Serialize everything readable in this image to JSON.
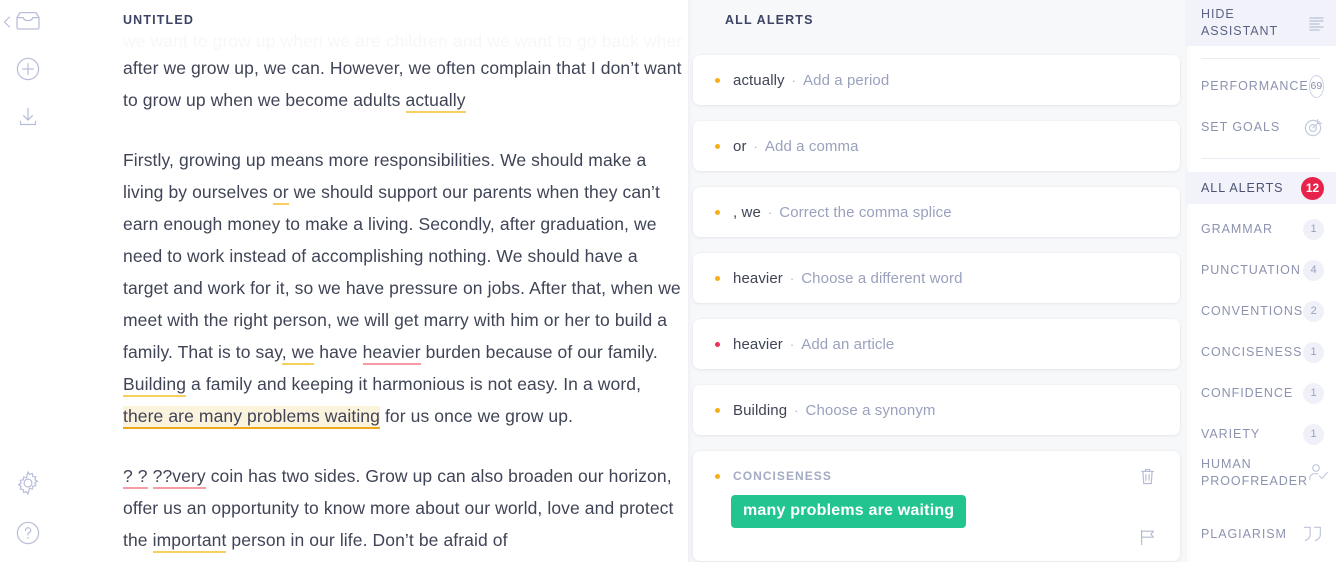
{
  "rail": {
    "back_icon": "chevron-left-icon",
    "icons": [
      {
        "name": "inbox-icon",
        "label": "Inbox"
      },
      {
        "name": "plus-circle-icon",
        "label": "New document"
      },
      {
        "name": "download-icon",
        "label": "Download"
      },
      {
        "name": "gear-icon",
        "label": "Settings"
      },
      {
        "name": "help-circle-icon",
        "label": "Help"
      }
    ]
  },
  "document": {
    "title": "UNTITLED",
    "ghost_line": "we want to grow up when we are children and we want to go back when",
    "paragraphs": [
      {
        "id": "p1",
        "runs": [
          {
            "t": "after we grow up, we can. However, we often complain that I don’t want to grow up when we become adults ",
            "mark": "none"
          },
          {
            "t": "actually",
            "mark": "yellow"
          }
        ]
      },
      {
        "id": "p2",
        "runs": [
          {
            "t": "Firstly, growing up means more responsibilities. We should make a living by ourselves ",
            "mark": "none"
          },
          {
            "t": "or",
            "mark": "yellow"
          },
          {
            "t": " we should support our parents when they can’t earn enough money to make a living. Secondly, after graduation, we need to work instead of accomplishing nothing. We should have a target and work for it, so we have pressure on jobs. After that, when we meet with the right person, we will get marry with him or her to build a family. That is to say",
            "mark": "none"
          },
          {
            "t": ", we",
            "mark": "yellow"
          },
          {
            "t": " have ",
            "mark": "none"
          },
          {
            "t": "heavier",
            "mark": "red"
          },
          {
            "t": " burden because of our family. ",
            "mark": "none"
          },
          {
            "t": "Building",
            "mark": "yellow"
          },
          {
            "t": " a family and keeping it harmonious is not easy. In a word, ",
            "mark": "none"
          },
          {
            "t": "there are many problems waiting",
            "mark": "active"
          },
          {
            "t": " for us once we grow up.",
            "mark": "none"
          }
        ]
      },
      {
        "id": "p3",
        "runs": [
          {
            "t": "? ?",
            "mark": "red"
          },
          {
            "t": " ",
            "mark": "none"
          },
          {
            "t": "??very",
            "mark": "red"
          },
          {
            "t": " coin has two sides. Grow up can also broaden our horizon, offer us an opportunity to know more about our world, love and protect the ",
            "mark": "none"
          },
          {
            "t": "important",
            "mark": "yellow"
          },
          {
            "t": " person in our life. Don’t be afraid of",
            "mark": "none"
          }
        ]
      }
    ]
  },
  "alerts": {
    "title": "ALL ALERTS",
    "separator": "·",
    "items": [
      {
        "word": "actually",
        "action": "Add a period",
        "severity": "amber"
      },
      {
        "word": "or",
        "action": "Add a comma",
        "severity": "amber"
      },
      {
        "word": ", we",
        "action": "Correct the comma splice",
        "severity": "amber"
      },
      {
        "word": "heavier",
        "action": "Choose a different word",
        "severity": "amber"
      },
      {
        "word": "heavier",
        "action": "Add an article",
        "severity": "red"
      },
      {
        "word": "Building",
        "action": "Choose a synonym",
        "severity": "amber"
      }
    ],
    "open_card": {
      "category": "CONCISENESS",
      "severity": "amber",
      "suggestion": "many problems are waiting",
      "suggestion_color": "#22c48f",
      "trash_icon": "trash-icon",
      "flag_icon": "flag-icon"
    }
  },
  "sidebar": {
    "hide_assistant": {
      "label": "HIDE ASSISTANT",
      "icon": "panel-lines-icon"
    },
    "performance": {
      "label": "PERFORMANCE",
      "score": "69"
    },
    "set_goals": {
      "label": "SET GOALS",
      "icon": "target-icon"
    },
    "categories": [
      {
        "label": "ALL ALERTS",
        "count": "12",
        "style": "red",
        "active": true
      },
      {
        "label": "GRAMMAR",
        "count": "1",
        "style": "grey",
        "active": false
      },
      {
        "label": "PUNCTUATION",
        "count": "4",
        "style": "grey",
        "active": false
      },
      {
        "label": "CONVENTIONS",
        "count": "2",
        "style": "grey",
        "active": false
      },
      {
        "label": "CONCISENESS",
        "count": "1",
        "style": "grey",
        "active": false
      },
      {
        "label": "CONFIDENCE",
        "count": "1",
        "style": "grey",
        "active": false
      },
      {
        "label": "VARIETY",
        "count": "1",
        "style": "grey",
        "active": false
      }
    ],
    "human_proofreader": {
      "label": "HUMAN PROOFREADER",
      "icon": "user-check-icon"
    },
    "plagiarism": {
      "label": "PLAGIARISM",
      "icon": "quotes-icon"
    }
  },
  "colors": {
    "amber": "#fbad17",
    "red": "#f0305a",
    "green": "#22c48f",
    "underline_yellow": "#f6cf5c",
    "underline_red": "#f79ca6",
    "highlight_bg": "#fcf3dd"
  }
}
